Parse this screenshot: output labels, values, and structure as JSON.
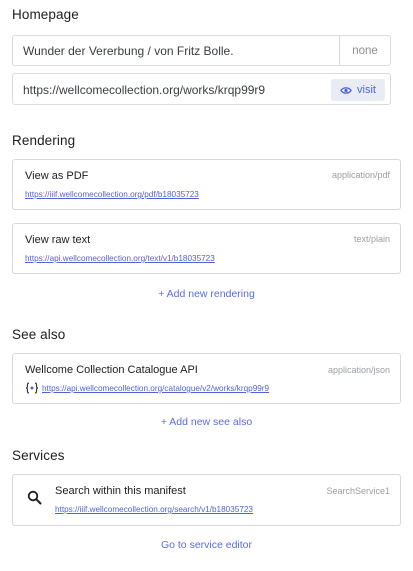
{
  "homepage": {
    "title": "Homepage",
    "label_value": "Wunder der Vererbung / von Fritz Bolle.",
    "language_button": "none",
    "url_value": "https://wellcomecollection.org/works/krqp99r9",
    "visit_label": "visit",
    "visit_icon": "eye-icon"
  },
  "rendering": {
    "title": "Rendering",
    "items": [
      {
        "label": "View as PDF",
        "format": "application/pdf",
        "url": "https://iiif.wellcomecollection.org/pdf/b18035723"
      },
      {
        "label": "View raw text",
        "format": "text/plain",
        "url": "https://api.wellcomecollection.org/text/v1/b18035723"
      }
    ],
    "add_label": "+ Add new rendering"
  },
  "see_also": {
    "title": "See also",
    "items": [
      {
        "label": "Wellcome Collection Catalogue API",
        "format": "application/json",
        "url": "https://api.wellcomecollection.org/catalogue/v2/works/krqp99r9",
        "icon": "json-braces-icon"
      }
    ],
    "add_label": "+ Add new see also"
  },
  "services": {
    "title": "Services",
    "items": [
      {
        "label": "Search within this manifest",
        "type": "SearchService1",
        "url": "https://iiif.wellcomecollection.org/search/v1/b18035723",
        "icon": "search-icon"
      }
    ],
    "editor_link": "Go to service editor"
  },
  "colors": {
    "accent": "#4f63d8",
    "border": "#d6d8dd",
    "muted": "#9a9da3"
  }
}
